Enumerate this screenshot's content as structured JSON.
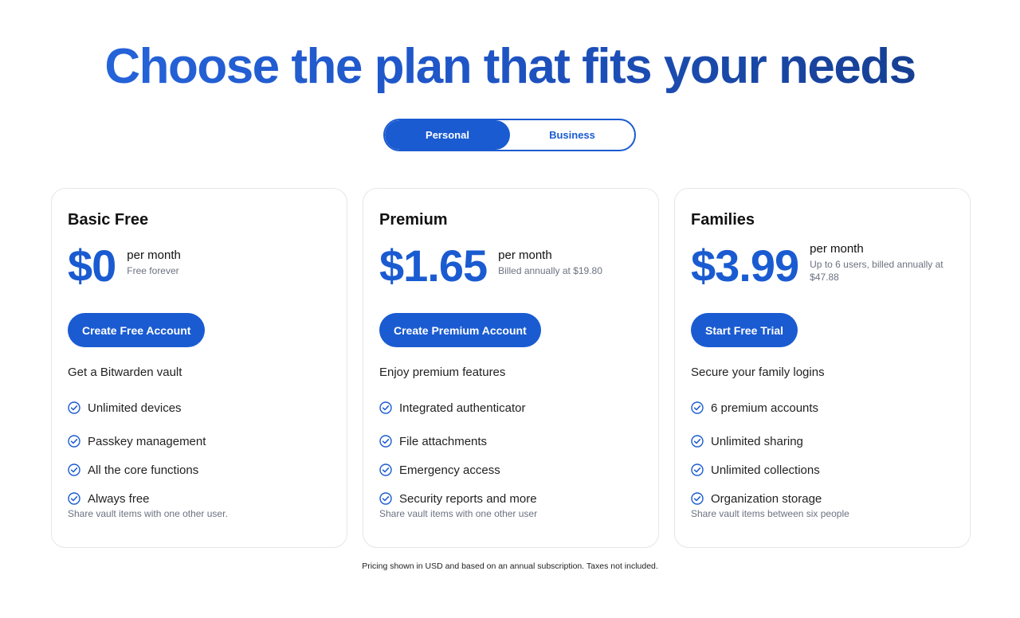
{
  "headline": "Choose the plan that fits your needs",
  "toggle": {
    "personal": "Personal",
    "business": "Business",
    "selected": "Personal"
  },
  "colors": {
    "accent": "#1a5bd1",
    "headline_gradient_end": "#163f93"
  },
  "plans": [
    {
      "name": "Basic Free",
      "price": "$0",
      "per": "per month",
      "note": "Free forever",
      "cta": "Create Free Account",
      "tagline": "Get a Bitwarden vault",
      "features": [
        "Unlimited devices",
        "Passkey management",
        "All the core functions",
        "Always free"
      ],
      "footnote": "Share vault items with one other user."
    },
    {
      "name": "Premium",
      "price": "$1.65",
      "per": "per month",
      "note": "Billed annually at $19.80",
      "cta": "Create Premium Account",
      "tagline": "Enjoy premium features",
      "features": [
        "Integrated authenticator",
        "File attachments",
        "Emergency access",
        "Security reports and more"
      ],
      "footnote": "Share vault items with one other user"
    },
    {
      "name": "Families",
      "price": "$3.99",
      "per": "per month",
      "note": "Up to 6 users, billed annually at $47.88",
      "cta": "Start Free Trial",
      "tagline": "Secure your family logins",
      "features": [
        "6 premium accounts",
        "Unlimited sharing",
        "Unlimited collections",
        "Organization storage"
      ],
      "footnote": "Share vault items between six people"
    }
  ],
  "feature_icon": "check-circle-icon",
  "disclaimer": "Pricing shown in USD and based on an annual subscription. Taxes not included."
}
